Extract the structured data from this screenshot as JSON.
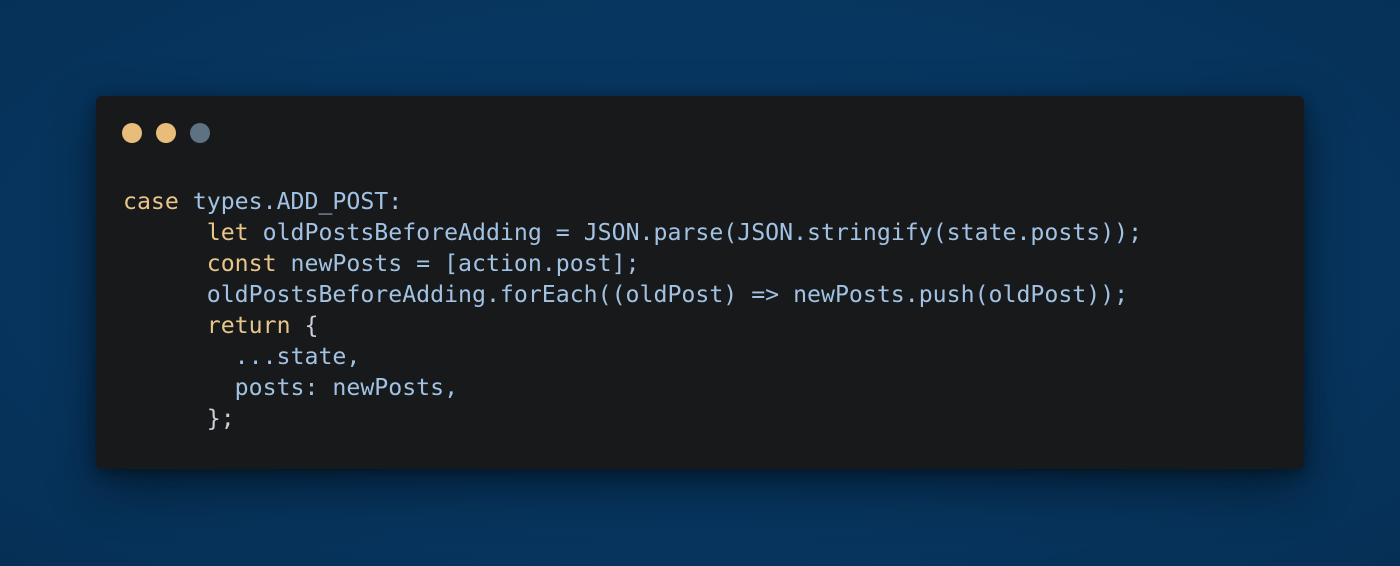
{
  "window": {
    "controls": [
      {
        "name": "close",
        "color": "#e8bd7a"
      },
      {
        "name": "minimize",
        "color": "#e8bd7a"
      },
      {
        "name": "maximize",
        "color": "#5d7383"
      }
    ]
  },
  "code": {
    "language": "javascript",
    "lines": [
      "case types.ADD_POST:",
      "      let oldPostsBeforeAdding = JSON.parse(JSON.stringify(state.posts));",
      "      const newPosts = [action.post];",
      "      oldPostsBeforeAdding.forEach((oldPost) => newPosts.push(oldPost));",
      "      return {",
      "        ...state,",
      "        posts: newPosts,",
      "      };"
    ],
    "tokens": {
      "l1_kw": "case",
      "l1_rest": " types.ADD_POST:",
      "l2_indent": "      ",
      "l2_kw": "let",
      "l2_rest": " oldPostsBeforeAdding = JSON.parse(JSON.stringify(state.posts));",
      "l3_indent": "      ",
      "l3_kw": "const",
      "l3_rest": " newPosts = [action.post];",
      "l4_rest": "      oldPostsBeforeAdding.forEach((oldPost) => newPosts.push(oldPost));",
      "l5_indent": "      ",
      "l5_kw": "return",
      "l5_rest": " {",
      "l6_rest": "        ...state,",
      "l7_rest": "        posts: newPosts,",
      "l8_rest": "      };"
    }
  },
  "colors": {
    "background": "#073660",
    "window": "#18191b",
    "keyword": "#e8c58a",
    "identifier": "#a2c2e3"
  }
}
